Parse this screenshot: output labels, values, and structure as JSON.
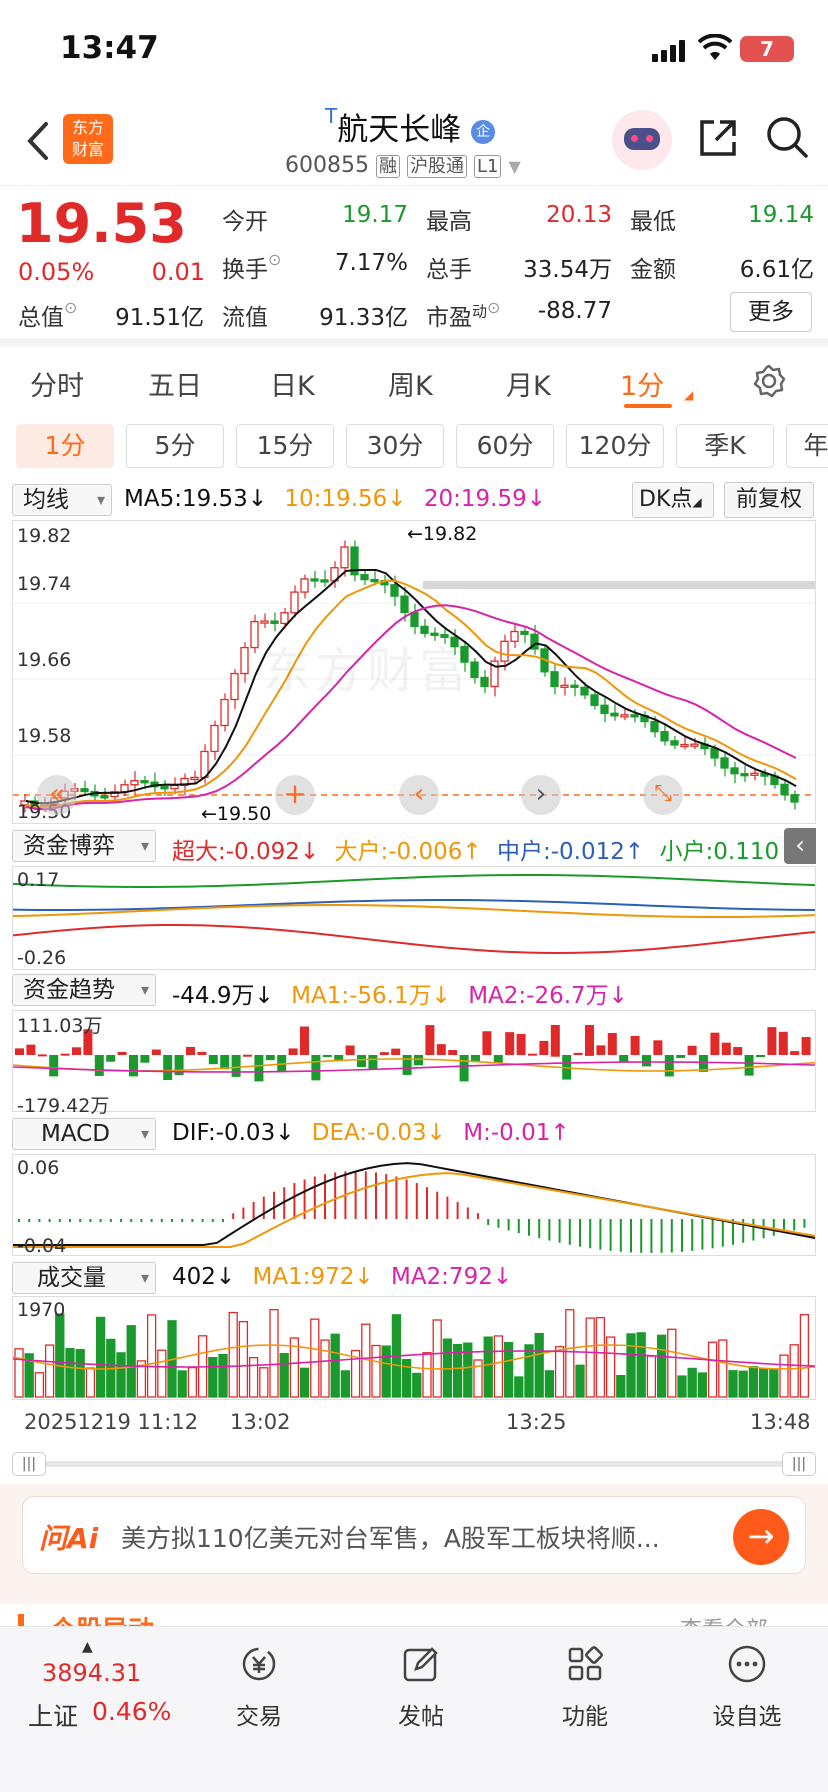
{
  "status_bar": {
    "time": "13:47",
    "battery": "7"
  },
  "header": {
    "logo_line1": "东方",
    "logo_line2": "财富",
    "title": "航天长峰",
    "title_prefix": "T",
    "badge": "企",
    "code": "600855",
    "tags": [
      "融",
      "沪股通",
      "L1"
    ]
  },
  "quote": {
    "price": "19.53",
    "change_pct": "0.05%",
    "change": "0.01",
    "rows": [
      {
        "l1": "今开",
        "v1": "19.17",
        "l2": "最高",
        "v2": "20.13",
        "l3": "最低",
        "v3": "19.14"
      },
      {
        "l1": "换手",
        "v1": "7.17%",
        "l2": "总手",
        "v2": "33.54万",
        "l3": "金额",
        "v3": "6.61亿"
      },
      {
        "l1": "总值",
        "v1": "91.51亿",
        "l2": "流值",
        "v2": "91.33亿",
        "l3": "市盈",
        "l3_sup": "动",
        "v3": "-88.77"
      }
    ],
    "more": "更多"
  },
  "tabs": [
    "分时",
    "五日",
    "日K",
    "周K",
    "月K",
    "1分"
  ],
  "periods": [
    "1分",
    "5分",
    "15分",
    "30分",
    "60分",
    "120分",
    "季K",
    "年"
  ],
  "main_chart": {
    "selector": "均线",
    "ma5": "MA5:19.53",
    "ma10": "10:19.56",
    "ma20": "20:19.59",
    "dk": "DK点",
    "adjust": "前复权",
    "y_labels": [
      "19.82",
      "19.74",
      "19.66",
      "19.58",
      "19.50"
    ],
    "high_mark": "←19.82",
    "low_mark": "←19.50",
    "watermark": "东方财富"
  },
  "fund_game": {
    "selector": "资金博弈",
    "super": "超大:-0.092",
    "big": "大户:-0.006",
    "mid": "中户:-0.012",
    "small": "小户:0.110",
    "y_top": "0.17",
    "y_bottom": "-0.26"
  },
  "fund_trend": {
    "selector": "资金趋势",
    "val": "-44.9万",
    "ma1": "MA1:-56.1万",
    "ma2": "MA2:-26.7万",
    "y_top": "111.03万",
    "y_bottom": "-179.42万"
  },
  "macd": {
    "selector": "MACD",
    "dif": "DIF:-0.03",
    "dea": "DEA:-0.03",
    "m": "M:-0.01",
    "y_top": "0.06",
    "y_bottom": "-0.04"
  },
  "volume": {
    "selector": "成交量",
    "val": "402",
    "ma1": "MA1:972",
    "ma2": "MA2:792",
    "y_top": "1970",
    "x_labels": [
      "20251219 11:12",
      "13:02",
      "13:25",
      "13:48"
    ]
  },
  "ai_banner": {
    "brand": "问Ai",
    "text": "美方拟110亿美元对台军售，A股军工板块将顺..."
  },
  "section_peek": {
    "title": "个股异动",
    "link": "查看全部"
  },
  "bottom_nav": {
    "index_value": "3894.31",
    "index_name": "上证",
    "index_pct": "0.46%",
    "items": [
      "交易",
      "发帖",
      "功能",
      "设自选"
    ]
  },
  "colors": {
    "up": "#e02a2a",
    "down": "#1a9a2c",
    "accent": "#ff6a1a"
  }
}
